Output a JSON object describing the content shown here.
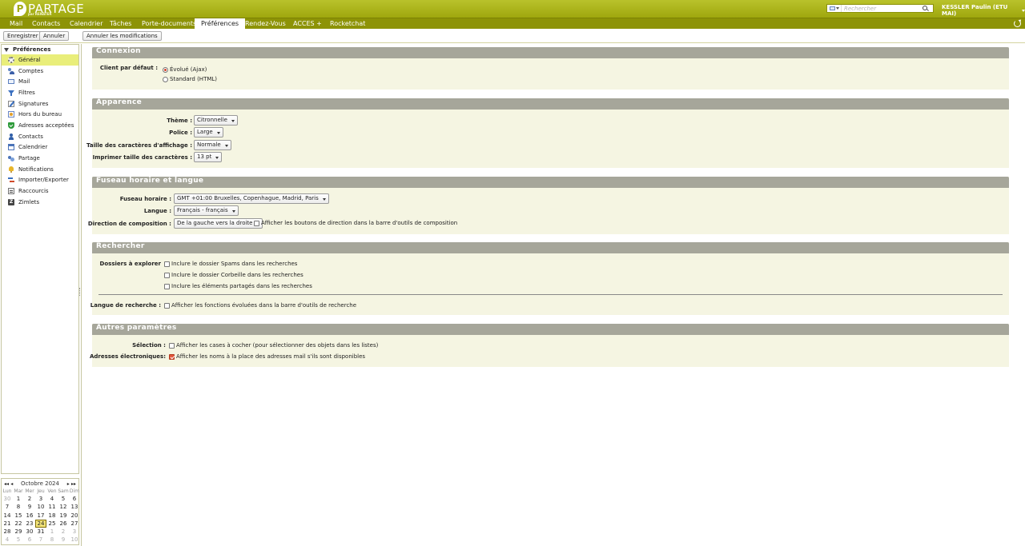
{
  "header": {
    "logo_mark": "P",
    "logo_text": "PARTAGE",
    "logo_sub": "par RENATER",
    "search_placeholder": "Rechercher",
    "user_name": "KESSLER Paulin (ETU MAI)"
  },
  "tabs": [
    {
      "label": "Mail"
    },
    {
      "label": "Contacts"
    },
    {
      "label": "Calendrier"
    },
    {
      "label": "Tâches"
    },
    {
      "label": "Porte-documents"
    },
    {
      "label": "Préférences",
      "active": true
    },
    {
      "label": "Rendez-Vous"
    },
    {
      "label": "ACCES +"
    },
    {
      "label": "Rocketchat"
    }
  ],
  "toolbar": {
    "save_label": "Enregistrer",
    "cancel_label": "Annuler",
    "undo_label": "Annuler les modifications"
  },
  "sidebar": {
    "header": "Préférences",
    "items": [
      {
        "label": "Général",
        "icon": "gear-icon",
        "selected": true
      },
      {
        "label": "Comptes",
        "icon": "accounts-icon"
      },
      {
        "label": "Mail",
        "icon": "mail-icon"
      },
      {
        "label": "Filtres",
        "icon": "filter-icon"
      },
      {
        "label": "Signatures",
        "icon": "signature-icon"
      },
      {
        "label": "Hors du bureau",
        "icon": "out-of-office-icon"
      },
      {
        "label": "Adresses acceptées",
        "icon": "shield-icon"
      },
      {
        "label": "Contacts",
        "icon": "contact-icon"
      },
      {
        "label": "Calendrier",
        "icon": "calendar-icon"
      },
      {
        "label": "Partage",
        "icon": "share-icon"
      },
      {
        "label": "Notifications",
        "icon": "notification-icon"
      },
      {
        "label": "Importer/Exporter",
        "icon": "import-export-icon"
      },
      {
        "label": "Raccourcis",
        "icon": "shortcut-icon"
      },
      {
        "label": "Zimlets",
        "icon": "zimlet-icon"
      }
    ]
  },
  "minical": {
    "title": "Octobre 2024",
    "nav": {
      "prev_year": "◂◂",
      "prev_month": "◂",
      "next_month": "▸",
      "next_year": "▸▸"
    },
    "dow": [
      "Lun",
      "Mar",
      "Mer",
      "Jeu",
      "Ven",
      "Sam",
      "Dim"
    ],
    "weeks": [
      [
        "30",
        "1",
        "2",
        "3",
        "4",
        "5",
        "6"
      ],
      [
        "7",
        "8",
        "9",
        "10",
        "11",
        "12",
        "13"
      ],
      [
        "14",
        "15",
        "16",
        "17",
        "18",
        "19",
        "20"
      ],
      [
        "21",
        "22",
        "23",
        "24",
        "25",
        "26",
        "27"
      ],
      [
        "28",
        "29",
        "30",
        "31",
        "1",
        "2",
        "3"
      ],
      [
        "4",
        "5",
        "6",
        "7",
        "8",
        "9",
        "10"
      ]
    ],
    "today": "24"
  },
  "sections": {
    "connexion": {
      "title": "Connexion",
      "client_label": "Client par défaut :",
      "opt_ajax": "Évolué (Ajax)",
      "opt_html": "Standard (HTML)"
    },
    "apparence": {
      "title": "Apparence",
      "theme_label": "Thème :",
      "theme_value": "Citronnelle",
      "font_label": "Police :",
      "font_value": "Large",
      "size_label": "Taille des caractères d'affichage :",
      "size_value": "Normale",
      "print_label": "Imprimer taille des caractères :",
      "print_value": "13 pt"
    },
    "fuseau": {
      "title": "Fuseau horaire et langue",
      "tz_label": "Fuseau horaire :",
      "tz_value": "GMT +01:00 Bruxelles, Copenhague, Madrid, Paris",
      "lang_label": "Langue :",
      "lang_value": "Français - français",
      "dir_label": "Direction de composition :",
      "dir_value": "De la gauche vers la droite",
      "dir_check": "Afficher les boutons de direction dans la barre d'outils de composition"
    },
    "rechercher": {
      "title": "Rechercher",
      "folders_label": "Dossiers à explorer",
      "spam": "Inclure le dossier Spams dans les recherches",
      "trash": "Inclure le dossier Corbeille dans les recherches",
      "shared": "Inclure les éléments partagés dans les recherches",
      "lang_label": "Langue de recherche :",
      "lang_check": "Afficher les fonctions évoluées dans la barre d'outils de recherche"
    },
    "autres": {
      "title": "Autres paramètres",
      "sel_label": "Sélection :",
      "sel_check": "Afficher les cases à cocher (pour sélectionner des objets dans les listes)",
      "addr_label": "Adresses électroniques:",
      "addr_check": "Afficher les noms à la place des adresses mail s'ils sont disponibles"
    }
  },
  "colors": {
    "brand": "#a2ab12",
    "tab_bar": "#8d9306",
    "section_header": "#a6a69a",
    "section_bg": "#f5f5e2",
    "selected_nav": "#e9ee7a"
  }
}
